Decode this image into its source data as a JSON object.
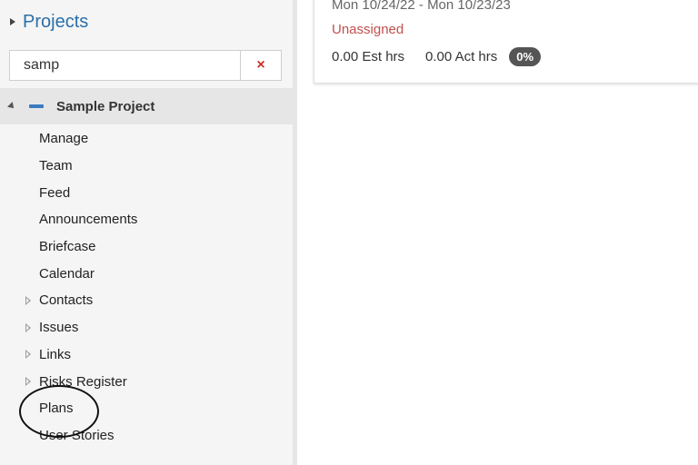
{
  "sidebar": {
    "title": "Projects",
    "search": {
      "value": "samp",
      "clear_icon": "×"
    },
    "project": {
      "name": "Sample Project"
    },
    "items": [
      {
        "label": "Manage",
        "expandable": false
      },
      {
        "label": "Team",
        "expandable": false
      },
      {
        "label": "Feed",
        "expandable": false
      },
      {
        "label": "Announcements",
        "expandable": false
      },
      {
        "label": "Briefcase",
        "expandable": false
      },
      {
        "label": "Calendar",
        "expandable": false
      },
      {
        "label": "Contacts",
        "expandable": true
      },
      {
        "label": "Issues",
        "expandable": true
      },
      {
        "label": "Links",
        "expandable": true
      },
      {
        "label": "Risks Register",
        "expandable": true
      },
      {
        "label": "Plans",
        "expandable": false
      },
      {
        "label": "User Stories",
        "expandable": false
      }
    ]
  },
  "card": {
    "dates": "Mon 10/24/22 - Mon 10/23/23",
    "assignee": "Unassigned",
    "est_hrs": "0.00 Est hrs",
    "act_hrs": "0.00 Act hrs",
    "percent": "0%"
  },
  "colors": {
    "accent": "#2a6fa8",
    "unassigned": "#c0504d",
    "clear": "#c9302c",
    "badge": "#555555"
  }
}
